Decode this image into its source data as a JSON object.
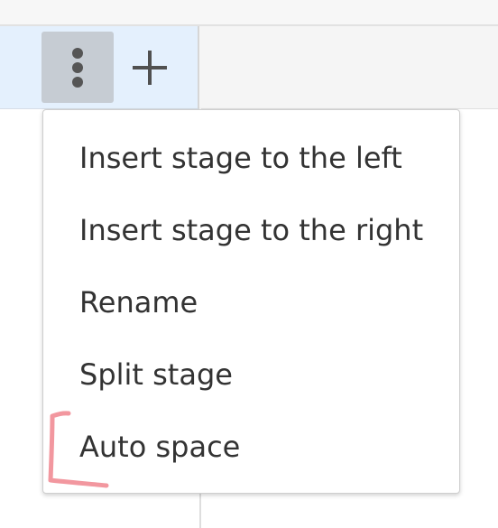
{
  "header": {
    "more_button": {
      "icon": "more-vertical-icon"
    },
    "add_button": {
      "icon": "plus-icon"
    }
  },
  "menu": {
    "items": [
      {
        "label": "Insert stage to the left"
      },
      {
        "label": "Insert stage to the right"
      },
      {
        "label": "Rename"
      },
      {
        "label": "Split stage"
      },
      {
        "label": "Auto space"
      }
    ]
  },
  "annotation": {
    "type": "bracket-mark",
    "color": "#f0858e"
  },
  "colors": {
    "stage_header_bg": "#e4f0fd",
    "kebab_button_bg": "#c6ccd3",
    "menu_text": "#333333"
  }
}
